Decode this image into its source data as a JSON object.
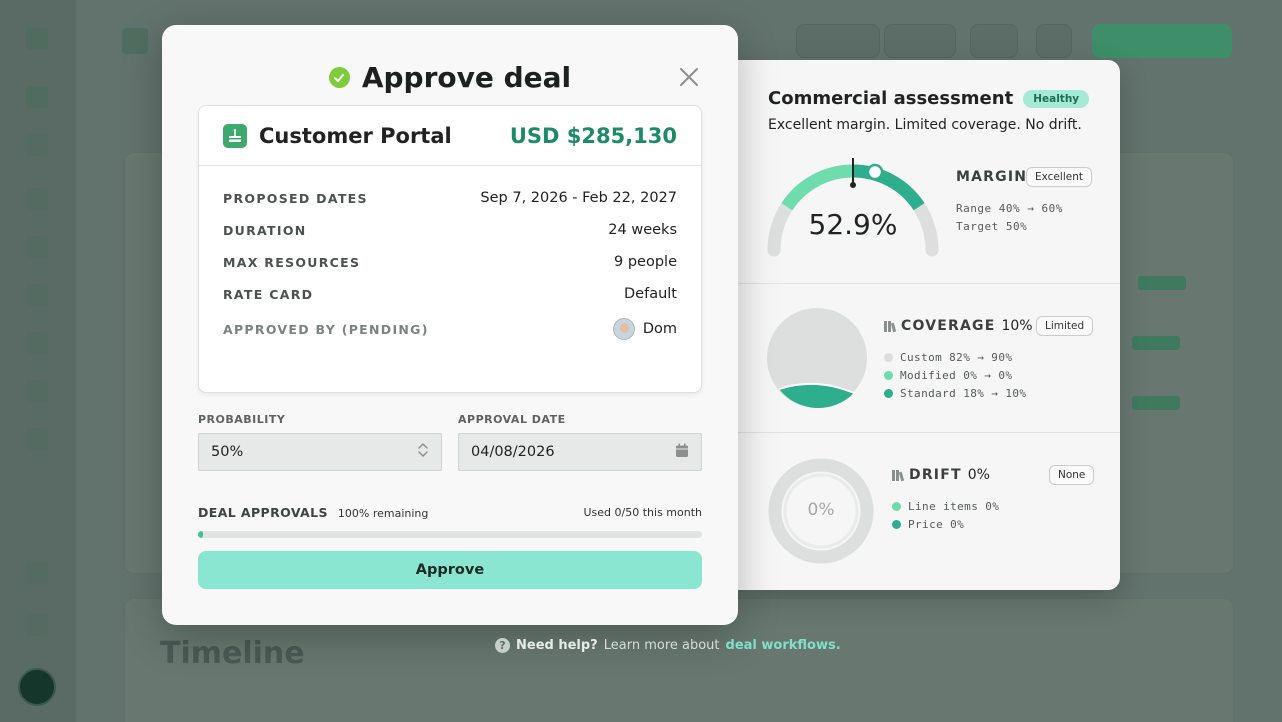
{
  "modal": {
    "title": "Approve deal",
    "card": {
      "name": "Customer Portal",
      "amount": "USD $285,130",
      "rows": [
        {
          "label": "PROPOSED DATES",
          "value": "Sep 7, 2026 - Feb 22, 2027"
        },
        {
          "label": "DURATION",
          "value": "24 weeks"
        },
        {
          "label": "MAX RESOURCES",
          "value": "9 people"
        },
        {
          "label": "RATE CARD",
          "value": "Default"
        }
      ],
      "approved_by_label": "APPROVED BY (PENDING)",
      "approved_by_value": "Dom"
    },
    "probability": {
      "label": "PROBABILITY",
      "value": "50%"
    },
    "approval_date": {
      "label": "APPROVAL DATE",
      "value": "04/08/2026"
    },
    "approvals": {
      "label": "DEAL APPROVALS",
      "remaining": "100% remaining",
      "used": "Used 0/50 this month",
      "used_fraction": 0.01
    },
    "approve_button": "Approve"
  },
  "assessment": {
    "title": "Commercial assessment",
    "status_badge": "Healthy",
    "summary": "Excellent margin. Limited coverage. No drift.",
    "margin": {
      "title": "MARGIN",
      "badge": "Excellent",
      "value": "52.9%",
      "range": "Range 40% → 60%",
      "target": "Target 50%"
    },
    "coverage": {
      "title": "COVERAGE",
      "pct": "10%",
      "badge": "Limited",
      "legend": [
        {
          "label": "Custom 82% → 90%",
          "color": "#dcdfde"
        },
        {
          "label": "Modified 0% → 0%",
          "color": "#6fdcae"
        },
        {
          "label": "Standard 18% → 10%",
          "color": "#2fae8e"
        }
      ]
    },
    "drift": {
      "title": "DRIFT",
      "pct": "0%",
      "badge": "None",
      "center": "0%",
      "legend": [
        {
          "label": "Line items 0%",
          "color": "#6fdcae"
        },
        {
          "label": "Price 0%",
          "color": "#2fae8e"
        }
      ]
    }
  },
  "help": {
    "strong": "Need help?",
    "text": "Learn more about",
    "link": "deal workflows."
  },
  "background": {
    "timeline_title": "Timeline"
  },
  "colors": {
    "accent": "#1e8a6a",
    "button": "#8ae6d1",
    "gauge_light": "#6fdcae",
    "gauge_dark": "#2fae8e",
    "track": "#dcdfde"
  }
}
